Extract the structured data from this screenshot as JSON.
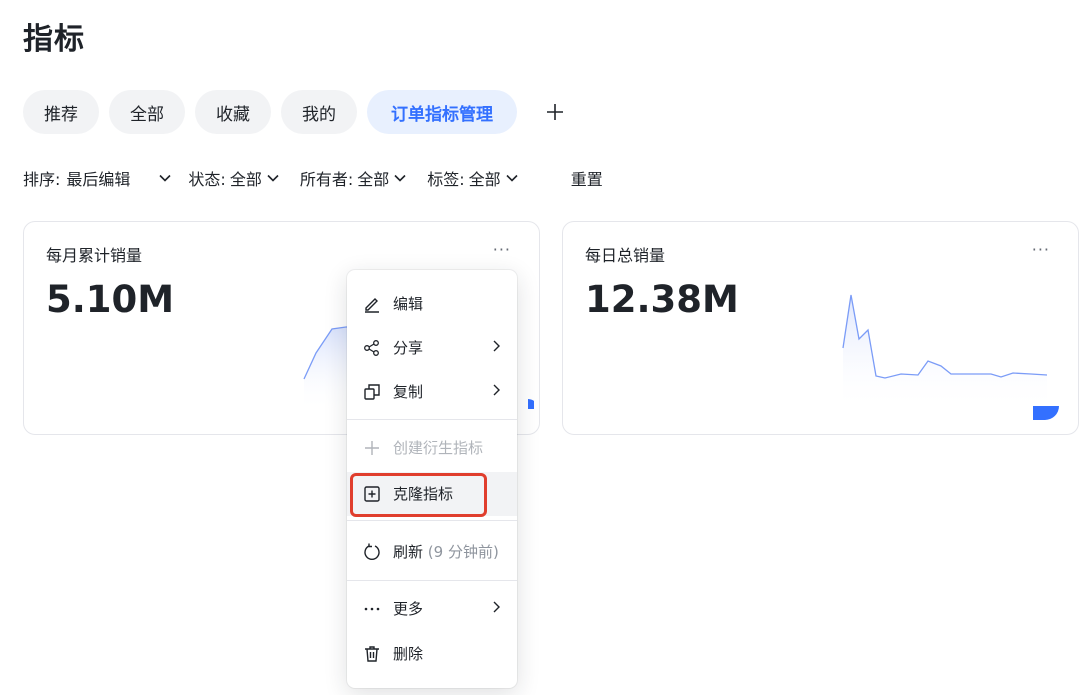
{
  "page": {
    "title": "指标"
  },
  "tabs": [
    {
      "label": "推荐",
      "active": false
    },
    {
      "label": "全部",
      "active": false
    },
    {
      "label": "收藏",
      "active": false
    },
    {
      "label": "我的",
      "active": false
    },
    {
      "label": "订单指标管理",
      "active": true
    }
  ],
  "tab_add_icon": "plus-icon",
  "filters": {
    "sort": {
      "label": "排序:",
      "value": "最后编辑"
    },
    "status": {
      "label": "状态:",
      "value": "全部"
    },
    "owner": {
      "label": "所有者:",
      "value": "全部"
    },
    "tag": {
      "label": "标签:",
      "value": "全部"
    },
    "reset": "重置"
  },
  "cards": [
    {
      "title": "每月累计销量",
      "value": "5.10M",
      "more": "···"
    },
    {
      "title": "每日总销量",
      "value": "12.38M",
      "more": "···"
    }
  ],
  "context_menu": {
    "items": [
      {
        "label": "编辑",
        "icon": "pencil-icon"
      },
      {
        "label": "分享",
        "icon": "share-icon",
        "has_submenu": true
      },
      {
        "label": "复制",
        "icon": "copy-icon",
        "has_submenu": true
      },
      {
        "label": "创建衍生指标",
        "icon": "plus-icon",
        "disabled": true
      },
      {
        "label": "克隆指标",
        "icon": "plus-square-icon",
        "highlighted": true
      },
      {
        "label": "刷新",
        "sub_label": "(9 分钟前)",
        "icon": "refresh-icon"
      },
      {
        "label": "更多",
        "icon": "more-icon",
        "has_submenu": true
      },
      {
        "label": "删除",
        "icon": "trash-icon"
      }
    ]
  },
  "colors": {
    "accent": "#3370ff",
    "active_tab_bg": "#e8f0fe",
    "tab_bg": "#f2f3f5",
    "highlight_border": "#e03e2d",
    "sparkline": "#7b9cf7"
  }
}
